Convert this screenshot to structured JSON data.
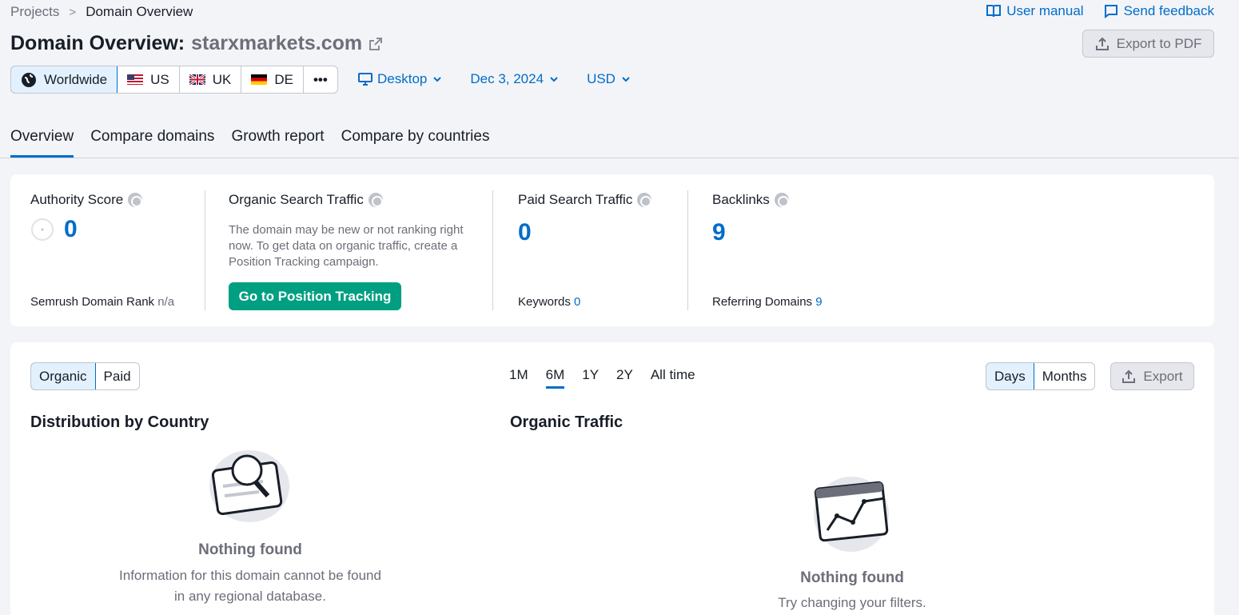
{
  "breadcrumb": {
    "projects": "Projects",
    "current": "Domain Overview"
  },
  "top_links": {
    "manual": "User manual",
    "feedback": "Send feedback"
  },
  "header": {
    "title_prefix": "Domain Overview:",
    "domain": "starxmarkets.com",
    "export_pdf": "Export to PDF"
  },
  "databases": {
    "worldwide": "Worldwide",
    "us": "US",
    "uk": "UK",
    "de": "DE",
    "more": "•••"
  },
  "filters": {
    "device": "Desktop",
    "date": "Dec 3, 2024",
    "currency": "USD"
  },
  "tabs": [
    "Overview",
    "Compare domains",
    "Growth report",
    "Compare by countries"
  ],
  "metrics": {
    "authority": {
      "title": "Authority Score",
      "value": "0",
      "sub_label": "Semrush Domain Rank",
      "sub_value": "n/a"
    },
    "organic": {
      "title": "Organic Search Traffic",
      "desc": "The domain may be new or not ranking right now. To get data on organic traffic, create a Position Tracking campaign.",
      "button": "Go to Position Tracking"
    },
    "paid": {
      "title": "Paid Search Traffic",
      "value": "0",
      "sub_label": "Keywords",
      "sub_value": "0"
    },
    "backlinks": {
      "title": "Backlinks",
      "value": "9",
      "sub_label": "Referring Domains",
      "sub_value": "9"
    }
  },
  "panel": {
    "source_toggle": [
      "Organic",
      "Paid"
    ],
    "periods": [
      "1M",
      "6M",
      "1Y",
      "2Y",
      "All time"
    ],
    "granularity": [
      "Days",
      "Months"
    ],
    "export": "Export",
    "distribution": {
      "title": "Distribution by Country",
      "empty_title": "Nothing found",
      "empty_text": "Information for this domain cannot be found in any regional database."
    },
    "traffic": {
      "title": "Organic Traffic",
      "empty_title": "Nothing found",
      "empty_text": "Try changing your filters."
    }
  },
  "colors": {
    "accent": "#006dca",
    "primary_button": "#009f81",
    "background": "#f3f4f8"
  }
}
